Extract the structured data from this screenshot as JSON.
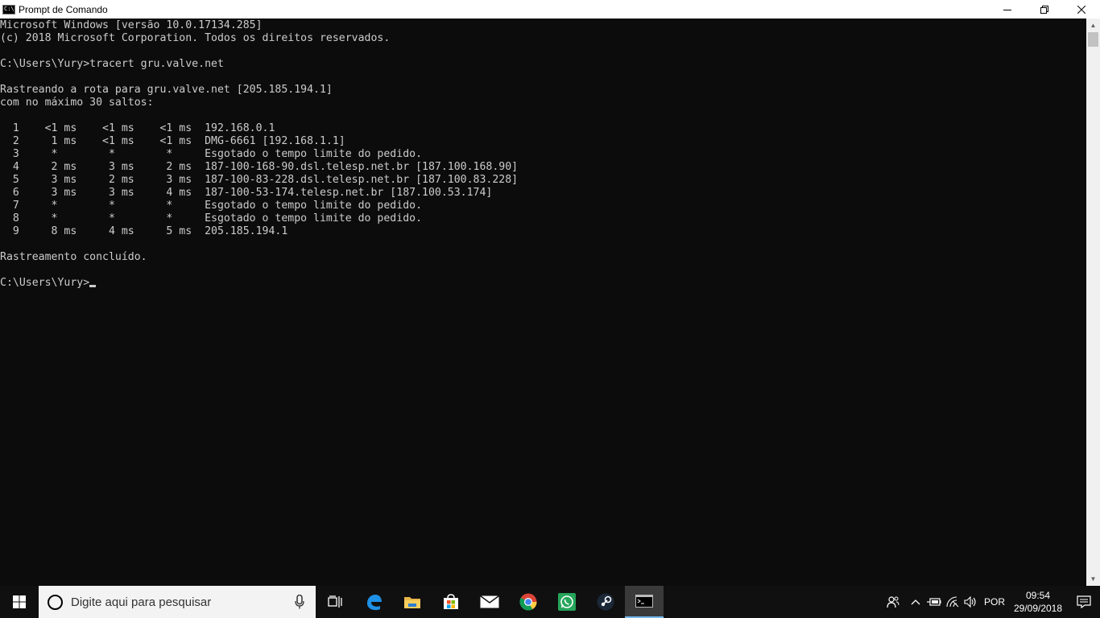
{
  "window": {
    "title": "Prompt de Comando"
  },
  "console": {
    "lines": [
      "Microsoft Windows [versão 10.0.17134.285]",
      "(c) 2018 Microsoft Corporation. Todos os direitos reservados.",
      "",
      "C:\\Users\\Yury>tracert gru.valve.net",
      "",
      "Rastreando a rota para gru.valve.net [205.185.194.1]",
      "com no máximo 30 saltos:",
      "",
      "  1    <1 ms    <1 ms    <1 ms  192.168.0.1",
      "  2     1 ms    <1 ms    <1 ms  DMG-6661 [192.168.1.1]",
      "  3     *        *        *     Esgotado o tempo limite do pedido.",
      "  4     2 ms     3 ms     2 ms  187-100-168-90.dsl.telesp.net.br [187.100.168.90]",
      "  5     3 ms     2 ms     3 ms  187-100-83-228.dsl.telesp.net.br [187.100.83.228]",
      "  6     3 ms     3 ms     4 ms  187-100-53-174.telesp.net.br [187.100.53.174]",
      "  7     *        *        *     Esgotado o tempo limite do pedido.",
      "  8     *        *        *     Esgotado o tempo limite do pedido.",
      "  9     8 ms     4 ms     5 ms  205.185.194.1",
      "",
      "Rastreamento concluído.",
      ""
    ],
    "prompt": "C:\\Users\\Yury>"
  },
  "taskbar": {
    "search_placeholder": "Digite aqui para pesquisar",
    "apps": [
      {
        "name": "task-view-icon"
      },
      {
        "name": "edge-icon"
      },
      {
        "name": "file-explorer-icon"
      },
      {
        "name": "store-icon"
      },
      {
        "name": "mail-icon"
      },
      {
        "name": "chrome-icon"
      },
      {
        "name": "whatsapp-icon"
      },
      {
        "name": "steam-icon"
      },
      {
        "name": "command-prompt-icon"
      }
    ],
    "tray": {
      "language": "POR",
      "time": "09:54",
      "date": "29/09/2018"
    }
  }
}
